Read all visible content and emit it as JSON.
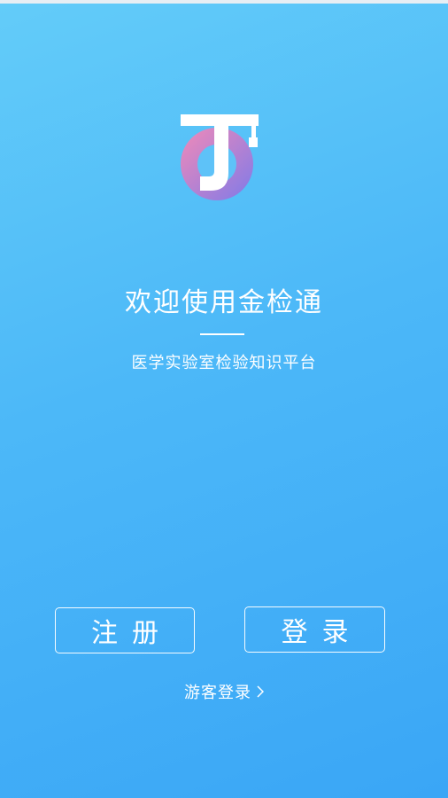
{
  "app": {
    "welcome_title": "欢迎使用金检通",
    "subtitle": "医学实验室检验知识平台",
    "logo_icon": "jinjiantong-logo-icon"
  },
  "actions": {
    "register_label": "注册",
    "login_label": "登录",
    "guest_login_label": "游客登录"
  },
  "colors": {
    "background_start": "#63ccf9",
    "background_end": "#3aa6f6",
    "logo_gradient_start": "#f18ab8",
    "logo_gradient_end": "#7f7ae8",
    "text": "#ffffff"
  }
}
